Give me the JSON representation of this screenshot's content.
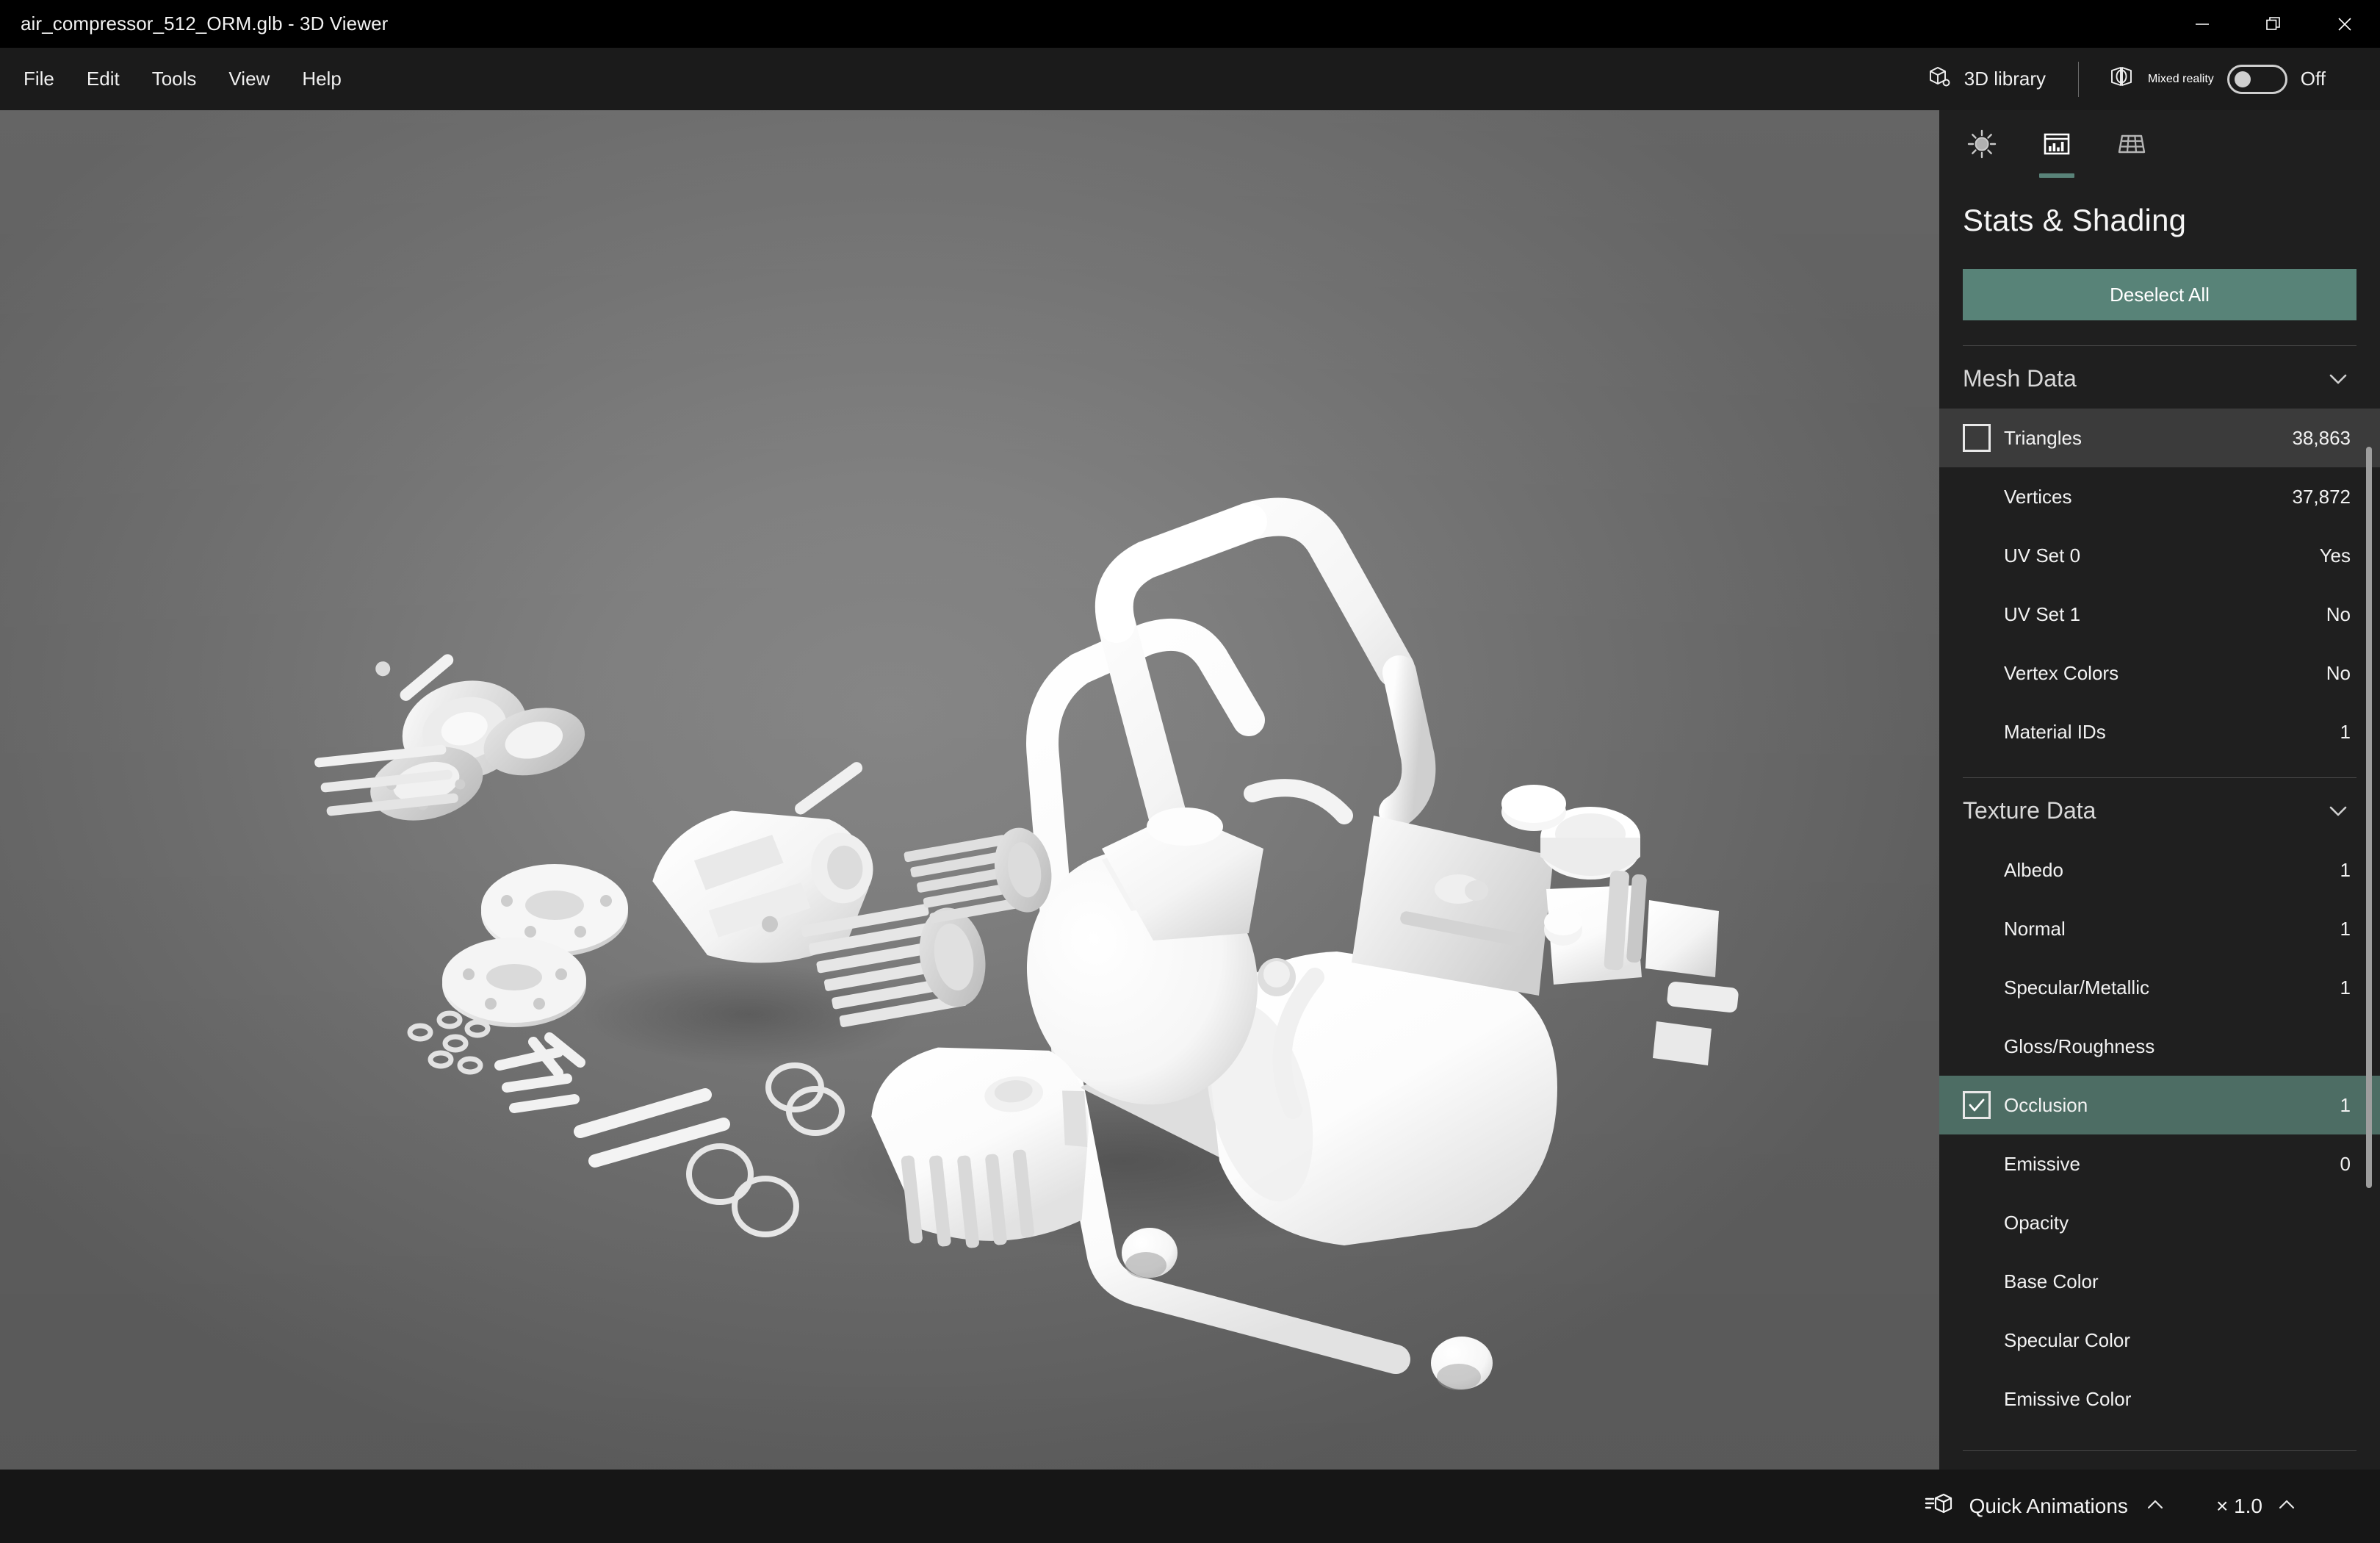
{
  "window": {
    "title": "air_compressor_512_ORM.glb - 3D Viewer",
    "minimize_icon": "minimize-icon",
    "restore_icon": "restore-icon",
    "close_icon": "close-icon"
  },
  "menubar": {
    "items": [
      {
        "label": "File"
      },
      {
        "label": "Edit"
      },
      {
        "label": "Tools"
      },
      {
        "label": "View"
      },
      {
        "label": "Help"
      }
    ],
    "library_button": {
      "label": "3D library",
      "icon": "3d-cube-icon"
    },
    "mixed_reality": {
      "label": "Mixed reality",
      "icon": "mixed-reality-icon",
      "toggle_state": "Off",
      "toggle_on": false
    }
  },
  "panel": {
    "tabs": [
      {
        "name": "lighting",
        "icon": "sun-icon",
        "active": false
      },
      {
        "name": "stats-shading",
        "icon": "bar-chart-icon",
        "active": true
      },
      {
        "name": "wireframe",
        "icon": "grid-icon",
        "active": false
      }
    ],
    "title": "Stats & Shading",
    "deselect_button": "Deselect All",
    "accent_color": "#588378",
    "selected_row_color": "#4d6d64",
    "hover_row_color": "#3b3b3b",
    "sections": [
      {
        "id": "mesh-data",
        "title": "Mesh Data",
        "expanded": true,
        "chevron": "chevron-down-icon",
        "rows": [
          {
            "label": "Triangles",
            "value": "38,863",
            "checkbox": true,
            "checked": false,
            "hovered": true,
            "selected": false
          },
          {
            "label": "Vertices",
            "value": "37,872",
            "checkbox": false,
            "checked": false,
            "hovered": false,
            "selected": false
          },
          {
            "label": "UV Set 0",
            "value": "Yes",
            "checkbox": false,
            "checked": false,
            "hovered": false,
            "selected": false
          },
          {
            "label": "UV Set 1",
            "value": "No",
            "checkbox": false,
            "checked": false,
            "hovered": false,
            "selected": false
          },
          {
            "label": "Vertex Colors",
            "value": "No",
            "checkbox": false,
            "checked": false,
            "hovered": false,
            "selected": false
          },
          {
            "label": "Material IDs",
            "value": "1",
            "checkbox": false,
            "checked": false,
            "hovered": false,
            "selected": false
          }
        ]
      },
      {
        "id": "texture-data",
        "title": "Texture Data",
        "expanded": true,
        "chevron": "chevron-down-icon",
        "rows": [
          {
            "label": "Albedo",
            "value": "1",
            "checkbox": false,
            "checked": false,
            "hovered": false,
            "selected": false
          },
          {
            "label": "Normal",
            "value": "1",
            "checkbox": false,
            "checked": false,
            "hovered": false,
            "selected": false
          },
          {
            "label": "Specular/Metallic",
            "value": "1",
            "checkbox": false,
            "checked": false,
            "hovered": false,
            "selected": false
          },
          {
            "label": "Gloss/Roughness",
            "value": "",
            "checkbox": false,
            "checked": false,
            "hovered": false,
            "selected": false
          },
          {
            "label": "Occlusion",
            "value": "1",
            "checkbox": true,
            "checked": true,
            "hovered": false,
            "selected": true
          },
          {
            "label": "Emissive",
            "value": "0",
            "checkbox": false,
            "checked": false,
            "hovered": false,
            "selected": false
          },
          {
            "label": "Opacity",
            "value": "",
            "checkbox": false,
            "checked": false,
            "hovered": false,
            "selected": false
          },
          {
            "label": "Base Color",
            "value": "",
            "checkbox": false,
            "checked": false,
            "hovered": false,
            "selected": false
          },
          {
            "label": "Specular Color",
            "value": "",
            "checkbox": false,
            "checked": false,
            "hovered": false,
            "selected": false
          },
          {
            "label": "Emissive Color",
            "value": "",
            "checkbox": false,
            "checked": false,
            "hovered": false,
            "selected": false
          }
        ]
      }
    ],
    "scrollbar": {
      "thumb_top_pct": 9,
      "thumb_height_pct": 66
    }
  },
  "bottombar": {
    "quick_animations": {
      "label": "Quick Animations",
      "icon": "animation-cube-icon",
      "chevron": "chevron-up-icon"
    },
    "speed": {
      "label": "× 1.0",
      "chevron": "chevron-up-icon"
    }
  },
  "viewport": {
    "model_name": "air_compressor",
    "background_center": "#858585",
    "background_edge": "#5e5e5e",
    "model_color": "#ffffff"
  }
}
